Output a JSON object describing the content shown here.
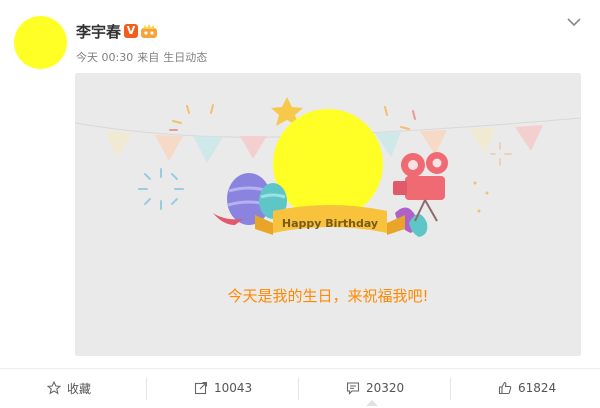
{
  "post": {
    "username": "李宇春",
    "verified_mark": "V",
    "time": "今天 00:30",
    "source_prefix": "来自",
    "source": "生日动态"
  },
  "card": {
    "ribbon_text": "Happy Birthday",
    "message": "今天是我的生日，来祝福我吧!"
  },
  "actions": {
    "favorite_label": "收藏",
    "repost_count": "10043",
    "comment_count": "20320",
    "like_count": "61824"
  },
  "colors": {
    "avatar": "#ffff26",
    "message": "#ff8a00",
    "verified": "#f25d1c"
  },
  "icons": [
    "star-icon",
    "share-icon",
    "comment-icon",
    "like-icon",
    "chevron-down-icon",
    "crown-badge-icon"
  ]
}
